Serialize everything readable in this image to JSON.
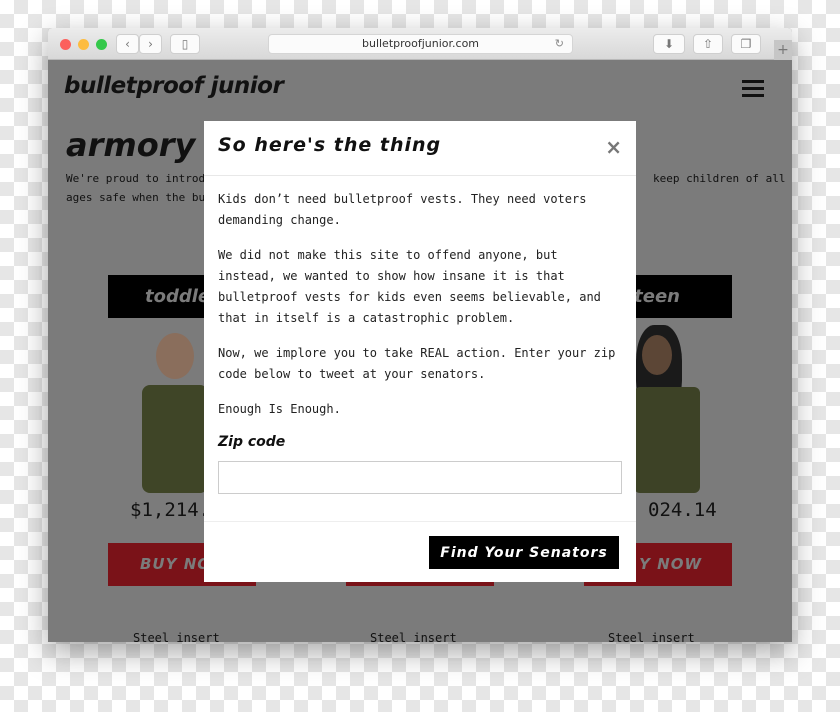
{
  "browser": {
    "url": "bulletproofjunior.com",
    "traffic_lights": [
      "#fc605c",
      "#fdbc40",
      "#34c84a"
    ]
  },
  "site": {
    "logo": "bulletproof junior",
    "heading": "armory",
    "intro_left_1": "We're proud to introduc",
    "intro_left_2": "ages safe when the bull",
    "intro_right": "keep children of all"
  },
  "products": [
    {
      "title": "toddle",
      "price": "$1,214.",
      "buy": "BUY NO",
      "feature": "Steel insert"
    },
    {
      "title": "",
      "price": "",
      "buy": "",
      "feature": "Steel insert"
    },
    {
      "title": "teen",
      "price": "024.14",
      "buy": "Y NOW",
      "feature": "Steel insert"
    }
  ],
  "modal": {
    "title": "So here's the thing",
    "close": "×",
    "paragraphs": [
      "Kids don’t need bulletproof vests. They need voters demanding change.",
      "We did not make this site to offend anyone, but instead, we wanted to show how insane it is that bulletproof vests for kids even seems believable, and that in itself is a catastrophic problem.",
      "Now, we implore you to take REAL action. Enter your zip code below to tweet at your senators.",
      "Enough Is Enough."
    ],
    "zip_label": "Zip code",
    "zip_value": "",
    "submit": "Find Your Senators"
  }
}
